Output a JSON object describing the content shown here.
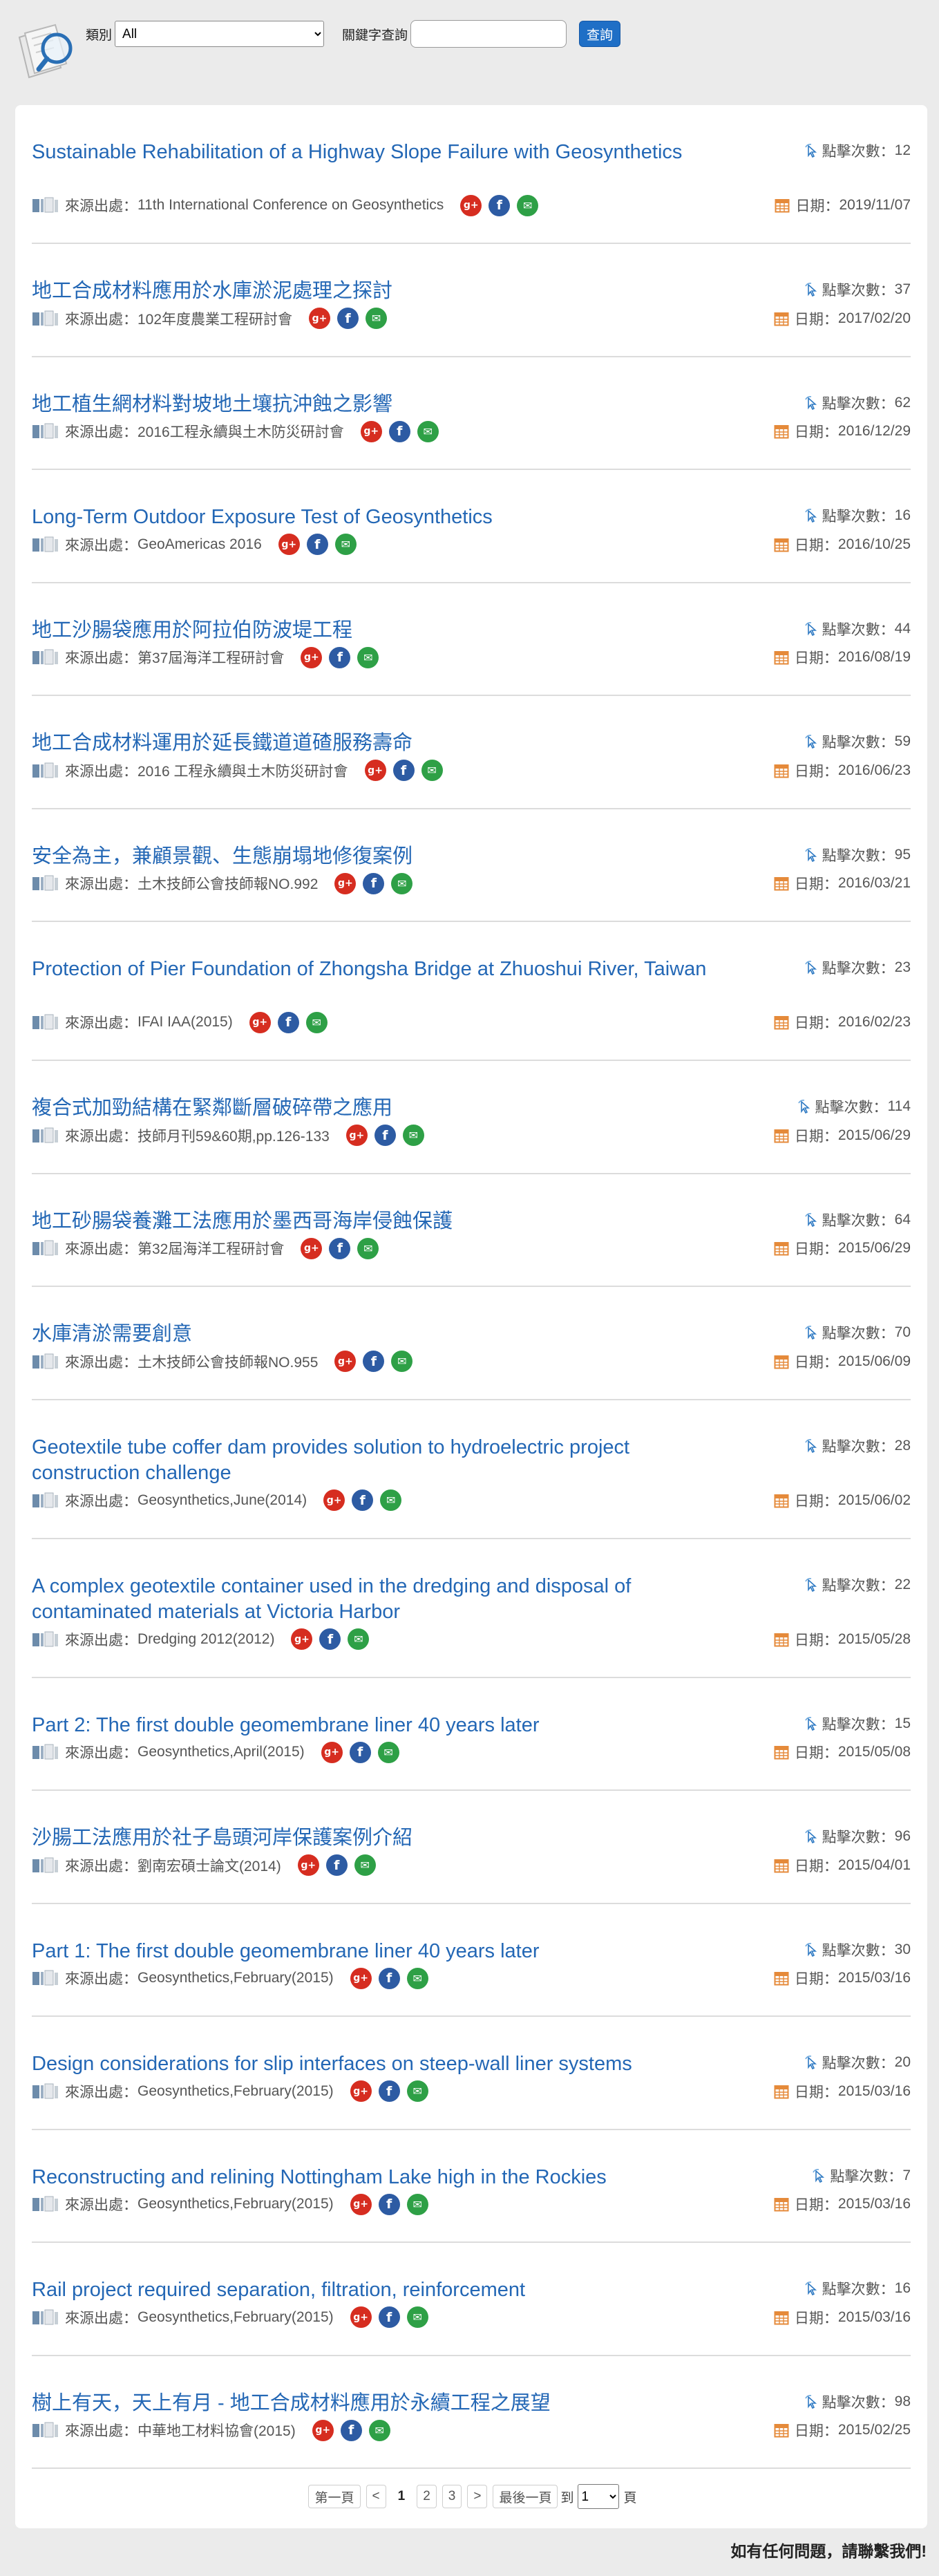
{
  "filter": {
    "category_label": "類別",
    "category_value": "All",
    "keyword_label": "關鍵字查詢",
    "keyword_value": "",
    "search_button": "查詢"
  },
  "labels": {
    "clicks_prefix": "點擊次數：",
    "source_prefix": "來源出處：",
    "date_prefix": "日期："
  },
  "articles": [
    {
      "title": "Sustainable Rehabilitation of a Highway Slope Failure with Geosynthetics",
      "source": "11th International Conference on Geosynthetics",
      "clicks": "12",
      "date": "2019/11/07"
    },
    {
      "title": "地工合成材料應用於水庫淤泥處理之探討",
      "source": "102年度農業工程研討會",
      "clicks": "37",
      "date": "2017/02/20"
    },
    {
      "title": "地工植生網材料對坡地土壤抗沖蝕之影響",
      "source": "2016工程永續與土木防災研討會",
      "clicks": "62",
      "date": "2016/12/29"
    },
    {
      "title": "Long-Term Outdoor Exposure Test of Geosynthetics",
      "source": "GeoAmericas 2016",
      "clicks": "16",
      "date": "2016/10/25"
    },
    {
      "title": "地工沙腸袋應用於阿拉伯防波堤工程",
      "source": "第37屆海洋工程研討會",
      "clicks": "44",
      "date": "2016/08/19"
    },
    {
      "title": "地工合成材料運用於延長鐵道道碴服務壽命",
      "source": "2016 工程永續與土木防災研討會",
      "clicks": "59",
      "date": "2016/06/23"
    },
    {
      "title": "安全為主，兼顧景觀、生態崩塌地修復案例",
      "source": "土木技師公會技師報NO.992",
      "clicks": "95",
      "date": "2016/03/21"
    },
    {
      "title": "Protection of Pier Foundation of Zhongsha Bridge at Zhuoshui River, Taiwan",
      "source": "IFAI IAA(2015)",
      "clicks": "23",
      "date": "2016/02/23"
    },
    {
      "title": "複合式加勁結構在緊鄰斷層破碎帶之應用",
      "source": "技師月刊59&60期,pp.126-133",
      "clicks": "114",
      "date": "2015/06/29"
    },
    {
      "title": "地工砂腸袋養灘工法應用於墨西哥海岸侵蝕保護",
      "source": "第32屆海洋工程研討會",
      "clicks": "64",
      "date": "2015/06/29"
    },
    {
      "title": "水庫清淤需要創意",
      "source": "土木技師公會技師報NO.955",
      "clicks": "70",
      "date": "2015/06/09"
    },
    {
      "title": "Geotextile tube coffer dam provides solution to hydroelectric project construction challenge",
      "source": "Geosynthetics,June(2014)",
      "clicks": "28",
      "date": "2015/06/02"
    },
    {
      "title": "A complex geotextile container used in the dredging and disposal of contaminated materials at Victoria Harbor",
      "source": "Dredging 2012(2012)",
      "clicks": "22",
      "date": "2015/05/28"
    },
    {
      "title": "Part 2: The first double geomembrane liner 40 years later",
      "source": "Geosynthetics,April(2015)",
      "clicks": "15",
      "date": "2015/05/08"
    },
    {
      "title": "沙腸工法應用於社子島頭河岸保護案例介紹",
      "source": "劉南宏碩士論文(2014)",
      "clicks": "96",
      "date": "2015/04/01"
    },
    {
      "title": "Part 1: The first double geomembrane liner 40 years later",
      "source": "Geosynthetics,February(2015)",
      "clicks": "30",
      "date": "2015/03/16"
    },
    {
      "title": "Design considerations for slip interfaces on steep-wall liner systems",
      "source": "Geosynthetics,February(2015)",
      "clicks": "20",
      "date": "2015/03/16"
    },
    {
      "title": "Reconstructing and relining Nottingham Lake high in the Rockies",
      "source": "Geosynthetics,February(2015)",
      "clicks": "7",
      "date": "2015/03/16"
    },
    {
      "title": "Rail project required separation, filtration, reinforcement",
      "source": "Geosynthetics,February(2015)",
      "clicks": "16",
      "date": "2015/03/16"
    },
    {
      "title": "樹上有天，天上有月 - 地工合成材料應用於永續工程之展望",
      "source": "中華地工材料協會(2015)",
      "clicks": "98",
      "date": "2015/02/25"
    }
  ],
  "pager": {
    "first": "第一頁",
    "prev": "<",
    "pages": [
      "1",
      "2",
      "3"
    ],
    "next": ">",
    "last": "最後一頁",
    "goto_prefix": "到",
    "goto_value": "1",
    "goto_suffix": "頁"
  },
  "footer_text": "如有任何問題，請聯繫我們!",
  "colors": {
    "title": "#2367b5",
    "button": "#1f6fc6",
    "google": "#d62d20",
    "facebook": "#2d5ba3",
    "mail": "#2ea046"
  },
  "icons": {
    "logo": "magnifier-document-icon",
    "clicks": "cursor-click-icon",
    "source": "book-icon",
    "date": "calendar-icon"
  }
}
